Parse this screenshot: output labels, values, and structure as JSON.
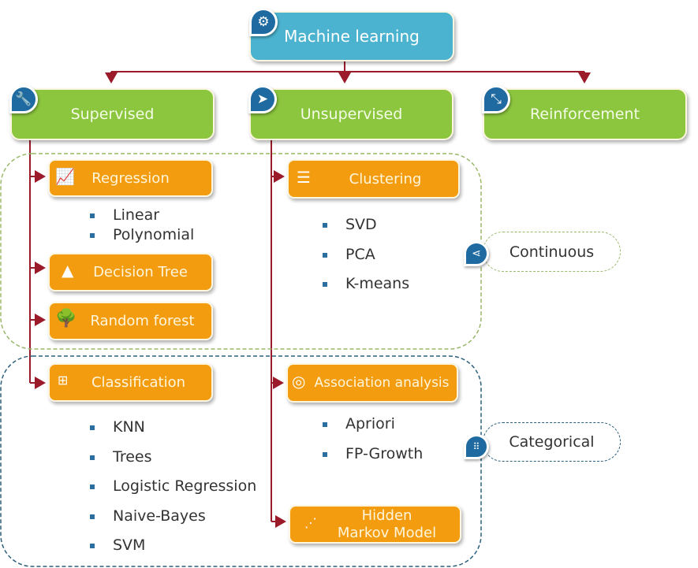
{
  "root": {
    "label": "Machine learning",
    "icon": "gears-icon"
  },
  "categories": [
    {
      "label": "Supervised",
      "icon": "wrench-icon"
    },
    {
      "label": "Unsupervised",
      "icon": "paper-plane-icon"
    },
    {
      "label": "Reinforcement",
      "icon": "compress-icon"
    }
  ],
  "supervised": {
    "regression": {
      "label": "Regression",
      "icon": "line-chart-icon",
      "items": [
        "Linear",
        "Polynomial"
      ]
    },
    "decision_tree": {
      "label": "Decision Tree",
      "icon": "pine-tree-icon"
    },
    "random_forest": {
      "label": "Random forest",
      "icon": "tree-icon"
    },
    "classification": {
      "label": "Classification",
      "icon": "hierarchy-icon",
      "items": [
        "KNN",
        "Trees",
        "Logistic Regression",
        "Naive-Bayes",
        "SVM"
      ]
    }
  },
  "unsupervised": {
    "clustering": {
      "label": "Clustering",
      "icon": "layers-icon",
      "items": [
        "SVD",
        "PCA",
        "K-means"
      ]
    },
    "association": {
      "label": "Association analysis",
      "icon": "network-icon",
      "items": [
        "Apriori",
        "FP-Growth"
      ]
    },
    "hmm": {
      "label_line1": "Hidden",
      "label_line2": "Markov Model",
      "icon": "path-icon"
    }
  },
  "groups": {
    "continuous": {
      "label": "Continuous",
      "icon": "share-icon",
      "color": "#9ab86a"
    },
    "categorical": {
      "label": "Categorical",
      "icon": "dots-grid-icon",
      "color": "#2c5f7c"
    }
  },
  "colors": {
    "root": "#4bb3cf",
    "category": "#8cc63f",
    "method": "#f39c0f",
    "connector": "#9b1b2a"
  }
}
